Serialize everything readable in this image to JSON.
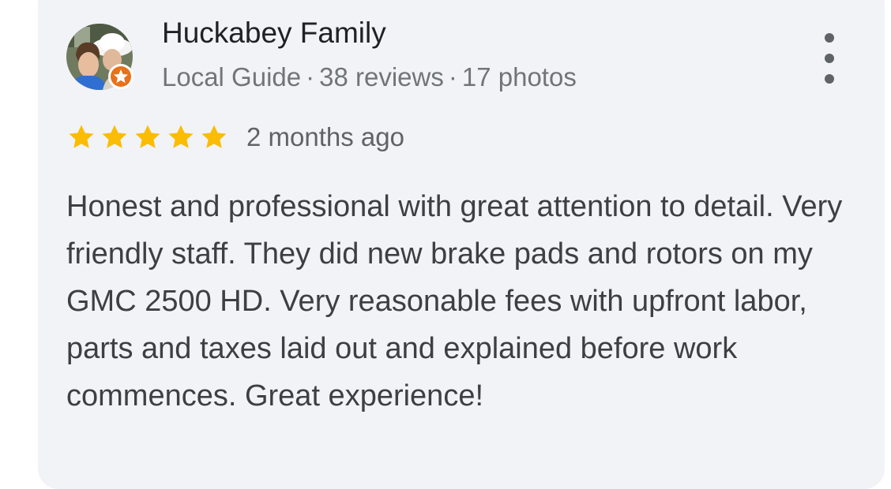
{
  "review": {
    "author": {
      "name": "Huckabey Family",
      "badge": "Local Guide",
      "reviews": "38 reviews",
      "photos": "17 photos",
      "separator": "·"
    },
    "rating": 5,
    "rating_max": 5,
    "date": "2 months ago",
    "text": "Honest and professional with great attention to detail. Very friendly staff. They did new brake pads and rotors on my GMC 2500 HD. Very reasonable fees with upfront labor, parts and taxes laid out and explained before work commences. Great experience!"
  },
  "icons": {
    "avatar": "user-photo",
    "guide_badge": "local-guide-star-badge",
    "more": "more-vert-icon",
    "star": "star-icon"
  },
  "colors": {
    "card_background": "#f2f3f7",
    "star": "#fbbc04",
    "guide_badge": "#e8711a",
    "name": "#202124",
    "meta": "#70757a",
    "body_text": "#3c4043"
  }
}
